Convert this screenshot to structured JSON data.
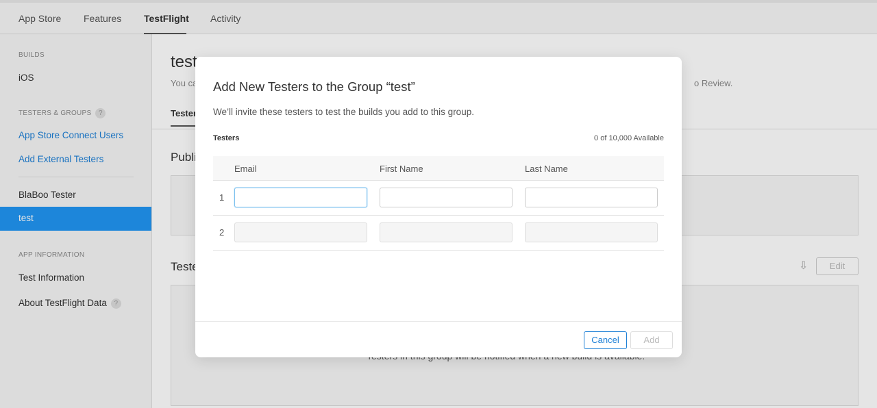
{
  "topnav": {
    "tabs": [
      {
        "label": "App Store"
      },
      {
        "label": "Features"
      },
      {
        "label": "TestFlight",
        "active": true
      },
      {
        "label": "Activity"
      }
    ]
  },
  "sidebar": {
    "builds_heading": "BUILDS",
    "ios": "iOS",
    "testers_heading": "TESTERS & GROUPS",
    "help": "?",
    "connect_users": "App Store Connect Users",
    "add_external": "Add External Testers",
    "group1": "BlaBoo Tester",
    "group2": "test",
    "app_info_heading": "APP INFORMATION",
    "test_info": "Test Information",
    "about": "About TestFlight Data"
  },
  "main": {
    "title": "test",
    "subtitle_start": "You ca",
    "subtitle_end": "o Review.",
    "tab": "Tester",
    "public_heading": "Publi",
    "testers_heading": "Teste",
    "edit": "Edit",
    "note": "Testers in this group will be notified when a new build is available."
  },
  "modal": {
    "title": "Add New Testers to the Group “test”",
    "description": "We’ll invite these testers to test the builds you add to this group.",
    "testers_label": "Testers",
    "available": "0 of 10,000 Available",
    "columns": [
      "Email",
      "First Name",
      "Last Name"
    ],
    "rows": [
      {
        "number": "1",
        "email": "",
        "first_name": "",
        "last_name": ""
      },
      {
        "number": "2",
        "email": "",
        "first_name": "",
        "last_name": ""
      }
    ],
    "cancel": "Cancel",
    "add": "Add"
  },
  "colors": {
    "accent": "#1c7fd6",
    "selected": "#2196f3"
  }
}
